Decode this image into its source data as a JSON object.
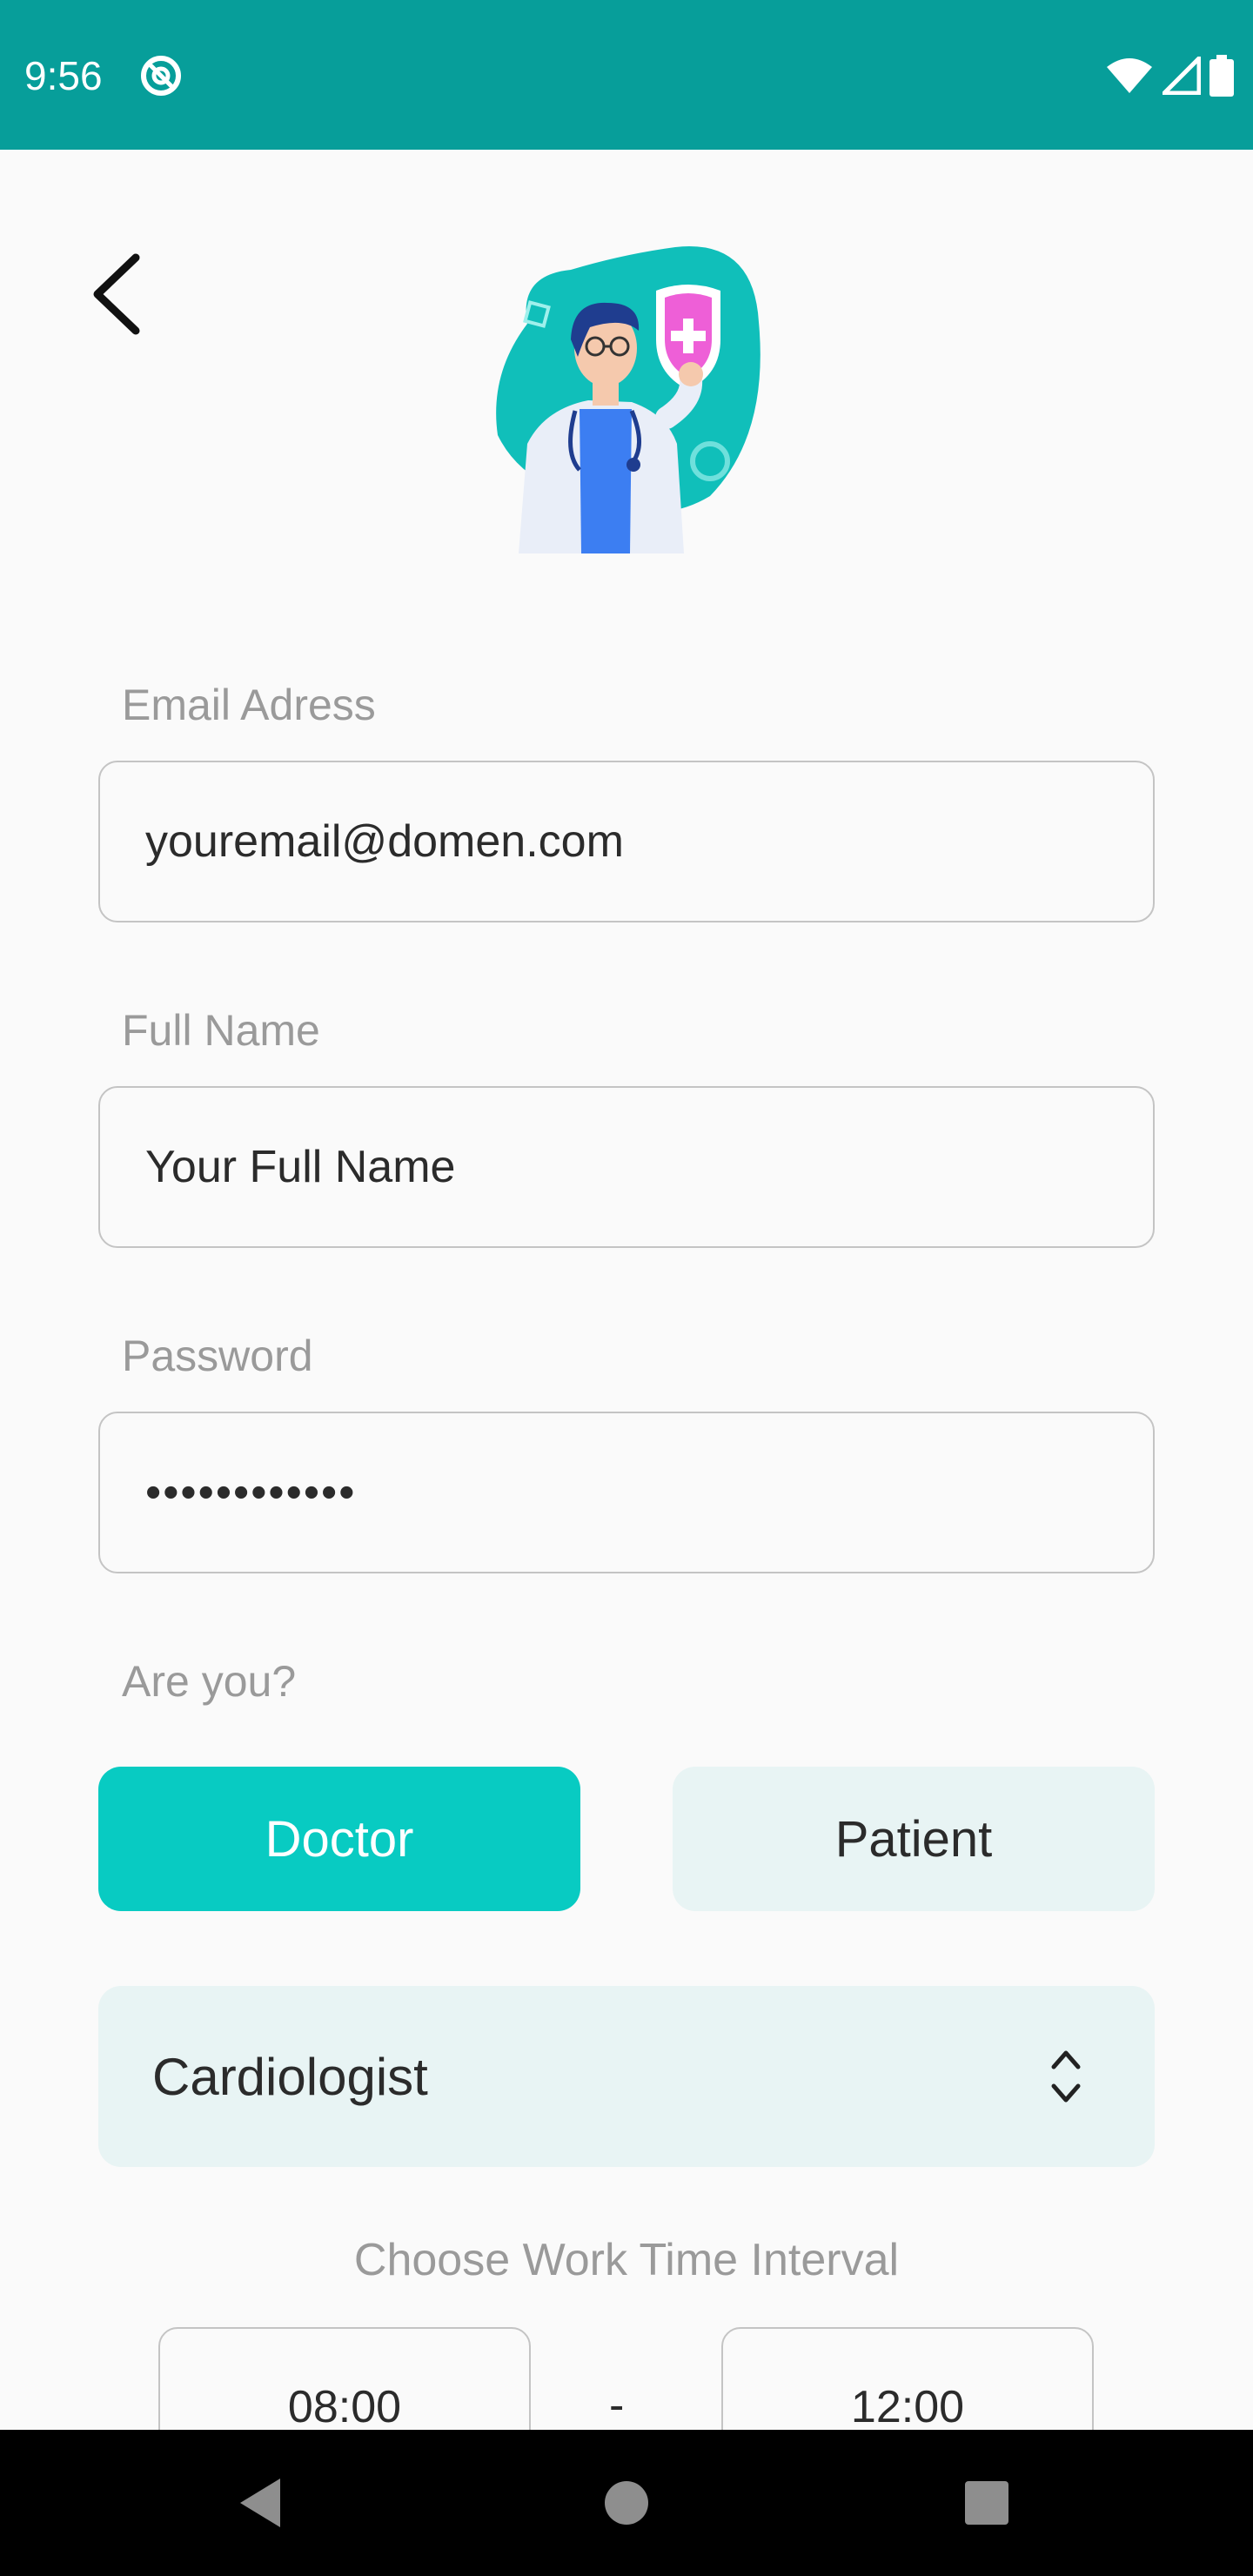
{
  "status_bar": {
    "time": "9:56",
    "background": "#079e9a"
  },
  "icons": {
    "back": "arrow-back-icon",
    "illustration": "doctor-illustration",
    "specialty": "chevron-up-down-icon"
  },
  "form": {
    "email": {
      "label": "Email Adress",
      "value": "youremail@domen.com"
    },
    "full_name": {
      "label": "Full Name",
      "value": "Your Full Name"
    },
    "password": {
      "label": "Password",
      "value": "••••••••••••"
    }
  },
  "role": {
    "question": "Are you?",
    "options": [
      "Doctor",
      "Patient"
    ],
    "selected": "Doctor"
  },
  "specialty": {
    "selected": "Cardiologist"
  },
  "work_time": {
    "label": "Choose Work Time Interval",
    "start": "08:00",
    "separator": "-",
    "end": "12:00"
  },
  "colors": {
    "accent": "#08cbc2",
    "status_bar": "#079e9a",
    "light_fill": "#e8f4f4",
    "label_gray": "#9a9a9a"
  }
}
